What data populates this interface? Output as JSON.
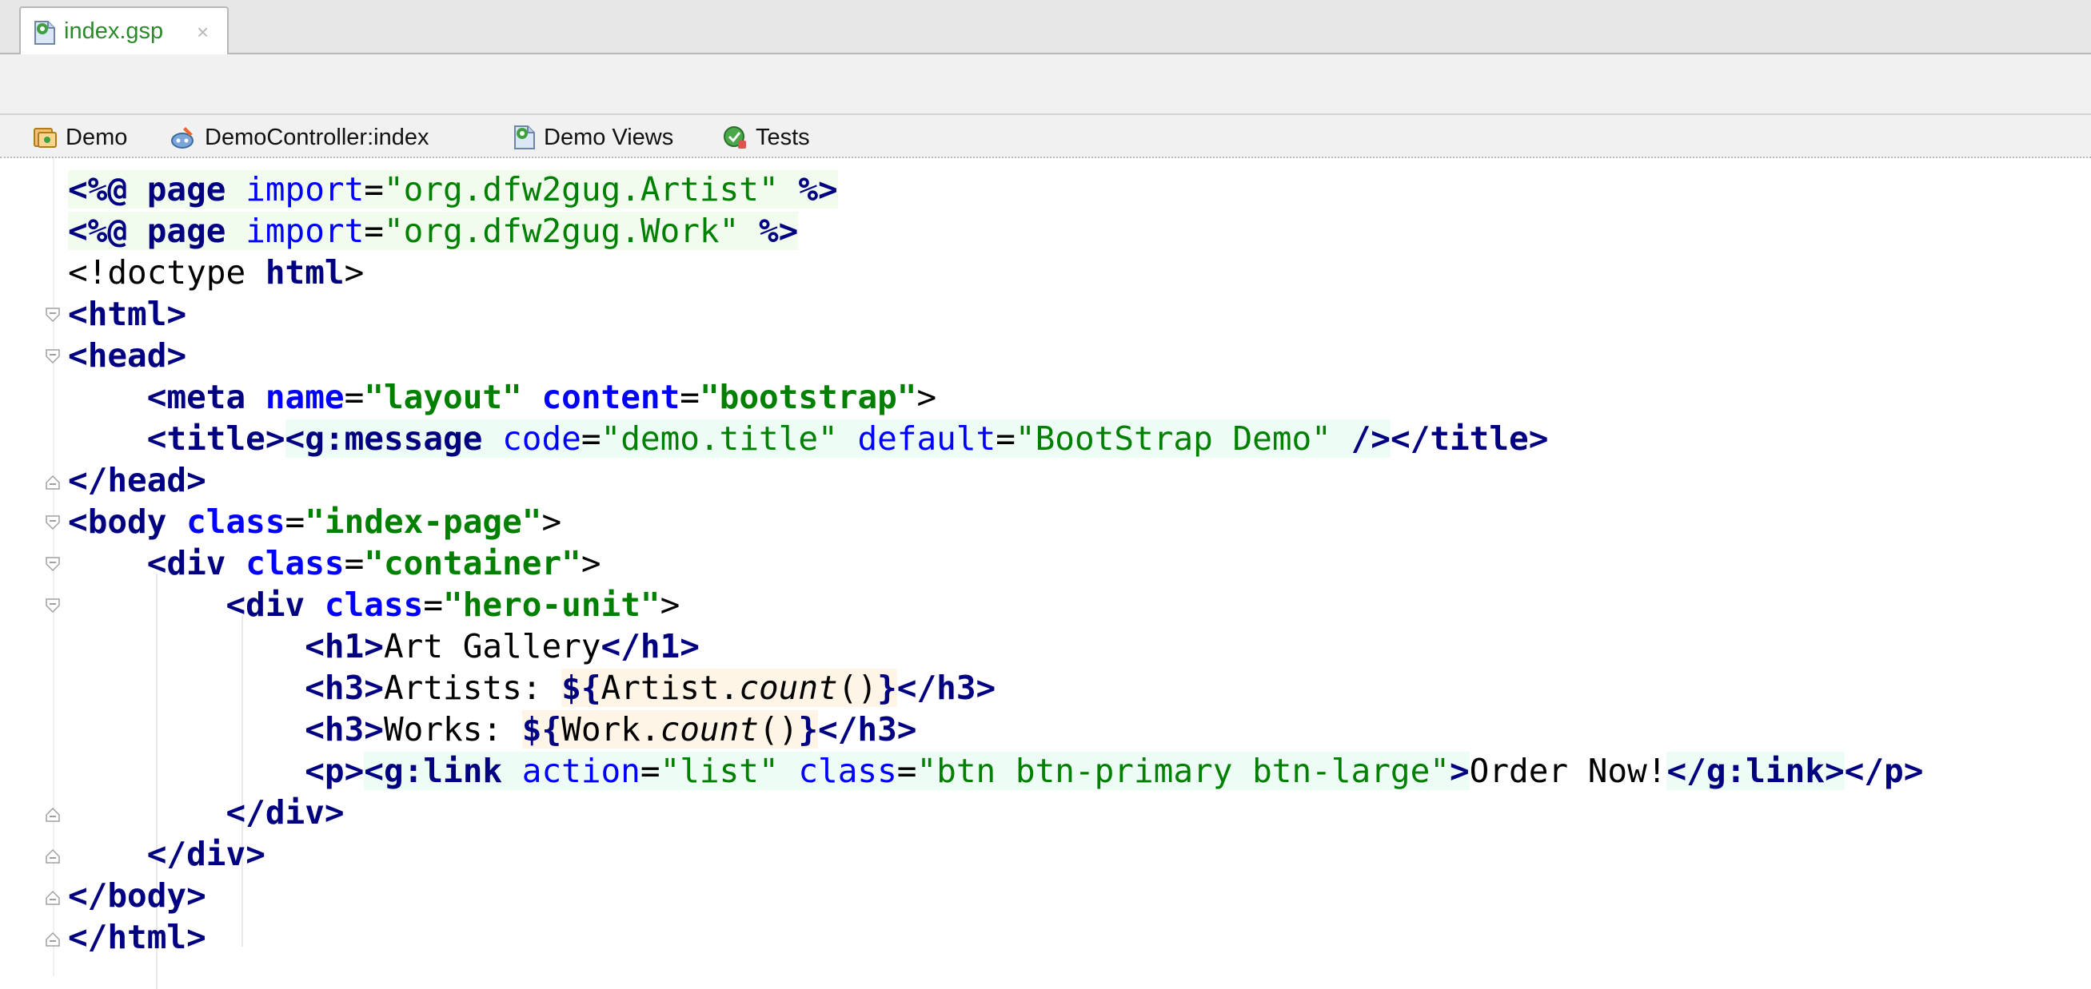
{
  "tab": {
    "label": "index.gsp",
    "close": "×"
  },
  "nav": {
    "items": [
      "Demo",
      "DemoController:index",
      "Demo Views",
      "Tests"
    ]
  },
  "code": {
    "lines": [
      [
        "<%@",
        " ",
        "page",
        " ",
        "import",
        "=",
        "\"org.dfw2gug.Artist\"",
        " ",
        "%>"
      ],
      [
        "<%@",
        " ",
        "page",
        " ",
        "import",
        "=",
        "\"org.dfw2gug.Work\"",
        " ",
        "%>"
      ],
      [
        "<!doctype",
        " ",
        "html",
        ">"
      ],
      [
        "<",
        "html",
        ">"
      ],
      [
        "<",
        "head",
        ">"
      ],
      [
        "    ",
        "<",
        "meta",
        " ",
        "name",
        "=",
        "\"layout\"",
        " ",
        "content",
        "=",
        "\"bootstrap\"",
        ">"
      ],
      [
        "    ",
        "<",
        "title",
        ">",
        "<",
        "g:message",
        " ",
        "code",
        "=",
        "\"demo.title\"",
        " ",
        "default",
        "=",
        "\"BootStrap Demo\"",
        " ",
        "/>",
        "</",
        "title",
        ">"
      ],
      [
        "</",
        "head",
        ">"
      ],
      [
        "<",
        "body",
        " ",
        "class",
        "=",
        "\"index-page\"",
        ">"
      ],
      [
        "    ",
        "<",
        "div",
        " ",
        "class",
        "=",
        "\"container\"",
        ">"
      ],
      [
        "        ",
        "<",
        "div",
        " ",
        "class",
        "=",
        "\"hero-unit\"",
        ">"
      ],
      [
        "            ",
        "<",
        "h1",
        ">",
        "Art Gallery",
        "</",
        "h1",
        ">"
      ],
      [
        "            ",
        "<",
        "h3",
        ">",
        "Artists: ",
        "${",
        "Artist.",
        "count",
        "()",
        "}",
        "</",
        "h3",
        ">"
      ],
      [
        "            ",
        "<",
        "h3",
        ">",
        "Works: ",
        "${",
        "Work.",
        "count",
        "()",
        "}",
        "</",
        "h3",
        ">"
      ],
      [
        "            ",
        "<",
        "p",
        ">",
        "<",
        "g:link",
        " ",
        "action",
        "=",
        "\"list\"",
        " ",
        "class",
        "=",
        "\"btn btn-primary btn-large\"",
        ">",
        "Order Now!",
        "</",
        "g:link",
        ">",
        "</",
        "p",
        ">"
      ],
      [
        "        ",
        "</",
        "div",
        ">"
      ],
      [
        "    ",
        "</",
        "div",
        ">"
      ],
      [
        "</",
        "body",
        ">"
      ],
      [
        "</",
        "html",
        ">"
      ]
    ]
  }
}
